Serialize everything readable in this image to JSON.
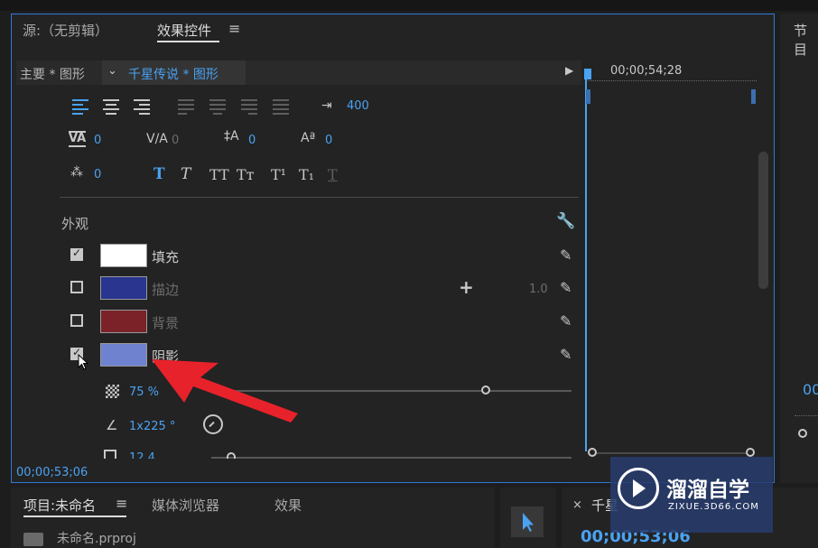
{
  "colors": {
    "accent": "#4aa2f2",
    "frame_blue": "#2f7ad8",
    "arrow": "#e8222a",
    "bg": "#232323"
  },
  "tabs": {
    "source": "源:（无剪辑）",
    "effect_controls": "效果控件",
    "program": "节目",
    "project": "项目:未命名",
    "media_browser": "媒体浏览器",
    "effects": "效果",
    "sequence": "千星"
  },
  "header": {
    "master": "主要 * 图形",
    "clip": "千星传说 * 图形",
    "timecode": "00;00;54;28"
  },
  "text_props": {
    "tab_width": "400",
    "kerning": "0",
    "tracking": "0",
    "leading": "0",
    "baseline": "0",
    "tsume": "0",
    "styles": [
      "T",
      "T",
      "TT",
      "Tт",
      "T¹",
      "T₁",
      "T"
    ]
  },
  "appearance": {
    "title": "外观",
    "fill_label": "填充",
    "stroke_label": "描边",
    "stroke_width": "1.0",
    "background_label": "背景",
    "shadow_label": "阴影",
    "opacity": "75 %",
    "angle": "1x225 °",
    "distance": "12.4",
    "fill_color": "#ffffff",
    "stroke_color": "#2a3590",
    "background_color": "#7a2228",
    "shadow_color": "#6f82cf"
  },
  "footer_timecode": "00;00;53;06",
  "program_partial_timecode": "00",
  "project": {
    "file": "未命名.prproj"
  },
  "sequence_timecode": "00;00;53;06",
  "watermark": {
    "title": "溜溜自学",
    "url": "ZIXUE.3D66.COM"
  }
}
